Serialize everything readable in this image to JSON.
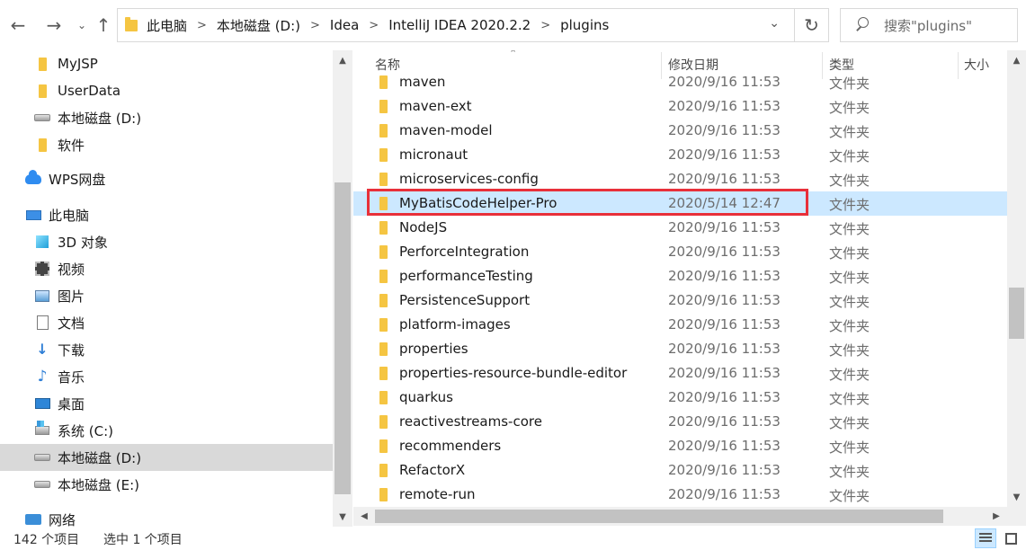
{
  "toolbar": {
    "back_icon": "arrow-left-icon",
    "forward_icon": "arrow-right-icon",
    "recent_icon": "chevron-down-icon",
    "up_icon": "arrow-up-icon",
    "breadcrumbs": [
      "此电脑",
      "本地磁盘 (D:)",
      "Idea",
      "IntelliJ IDEA 2020.2.2",
      "plugins"
    ],
    "separator": ">",
    "refresh_icon": "refresh-icon",
    "search_placeholder": "搜索\"plugins\""
  },
  "sidebar": {
    "items": [
      {
        "label": "MyJSP",
        "icon": "folder-icon"
      },
      {
        "label": "UserData",
        "icon": "folder-icon"
      },
      {
        "label": "本地磁盘 (D:)",
        "icon": "drive-icon"
      },
      {
        "label": "软件",
        "icon": "folder-icon"
      },
      {
        "label": "WPS网盘",
        "icon": "cloud-icon"
      },
      {
        "label": "此电脑",
        "icon": "computer-icon"
      },
      {
        "label": "3D 对象",
        "icon": "cube-icon"
      },
      {
        "label": "视频",
        "icon": "video-icon"
      },
      {
        "label": "图片",
        "icon": "picture-icon"
      },
      {
        "label": "文档",
        "icon": "document-icon"
      },
      {
        "label": "下载",
        "icon": "download-icon"
      },
      {
        "label": "音乐",
        "icon": "music-icon"
      },
      {
        "label": "桌面",
        "icon": "desktop-icon"
      },
      {
        "label": "系统 (C:)",
        "icon": "system-drive-icon"
      },
      {
        "label": "本地磁盘 (D:)",
        "icon": "drive-icon"
      },
      {
        "label": "本地磁盘 (E:)",
        "icon": "drive-icon"
      },
      {
        "label": "网络",
        "icon": "network-icon"
      }
    ],
    "selected_index": 14
  },
  "columns": {
    "name": "名称",
    "date": "修改日期",
    "type": "类型",
    "size": "大小"
  },
  "files": [
    {
      "name": "maven",
      "date": "2020/9/16 11:53",
      "type": "文件夹"
    },
    {
      "name": "maven-ext",
      "date": "2020/9/16 11:53",
      "type": "文件夹"
    },
    {
      "name": "maven-model",
      "date": "2020/9/16 11:53",
      "type": "文件夹"
    },
    {
      "name": "micronaut",
      "date": "2020/9/16 11:53",
      "type": "文件夹"
    },
    {
      "name": "microservices-config",
      "date": "2020/9/16 11:53",
      "type": "文件夹"
    },
    {
      "name": "MyBatisCodeHelper-Pro",
      "date": "2020/5/14 12:47",
      "type": "文件夹"
    },
    {
      "name": "NodeJS",
      "date": "2020/9/16 11:53",
      "type": "文件夹"
    },
    {
      "name": "PerforceIntegration",
      "date": "2020/9/16 11:53",
      "type": "文件夹"
    },
    {
      "name": "performanceTesting",
      "date": "2020/9/16 11:53",
      "type": "文件夹"
    },
    {
      "name": "PersistenceSupport",
      "date": "2020/9/16 11:53",
      "type": "文件夹"
    },
    {
      "name": "platform-images",
      "date": "2020/9/16 11:53",
      "type": "文件夹"
    },
    {
      "name": "properties",
      "date": "2020/9/16 11:53",
      "type": "文件夹"
    },
    {
      "name": "properties-resource-bundle-editor",
      "date": "2020/9/16 11:53",
      "type": "文件夹"
    },
    {
      "name": "quarkus",
      "date": "2020/9/16 11:53",
      "type": "文件夹"
    },
    {
      "name": "reactivestreams-core",
      "date": "2020/9/16 11:53",
      "type": "文件夹"
    },
    {
      "name": "recommenders",
      "date": "2020/9/16 11:53",
      "type": "文件夹"
    },
    {
      "name": "RefactorX",
      "date": "2020/9/16 11:53",
      "type": "文件夹"
    },
    {
      "name": "remote-run",
      "date": "2020/9/16 11:53",
      "type": "文件夹"
    }
  ],
  "selected_file_index": 5,
  "highlight_color": "#e8303a",
  "selection_color": "#cce8ff",
  "status": {
    "item_count": "142 个项目",
    "selected_count": "选中 1 个项目"
  }
}
